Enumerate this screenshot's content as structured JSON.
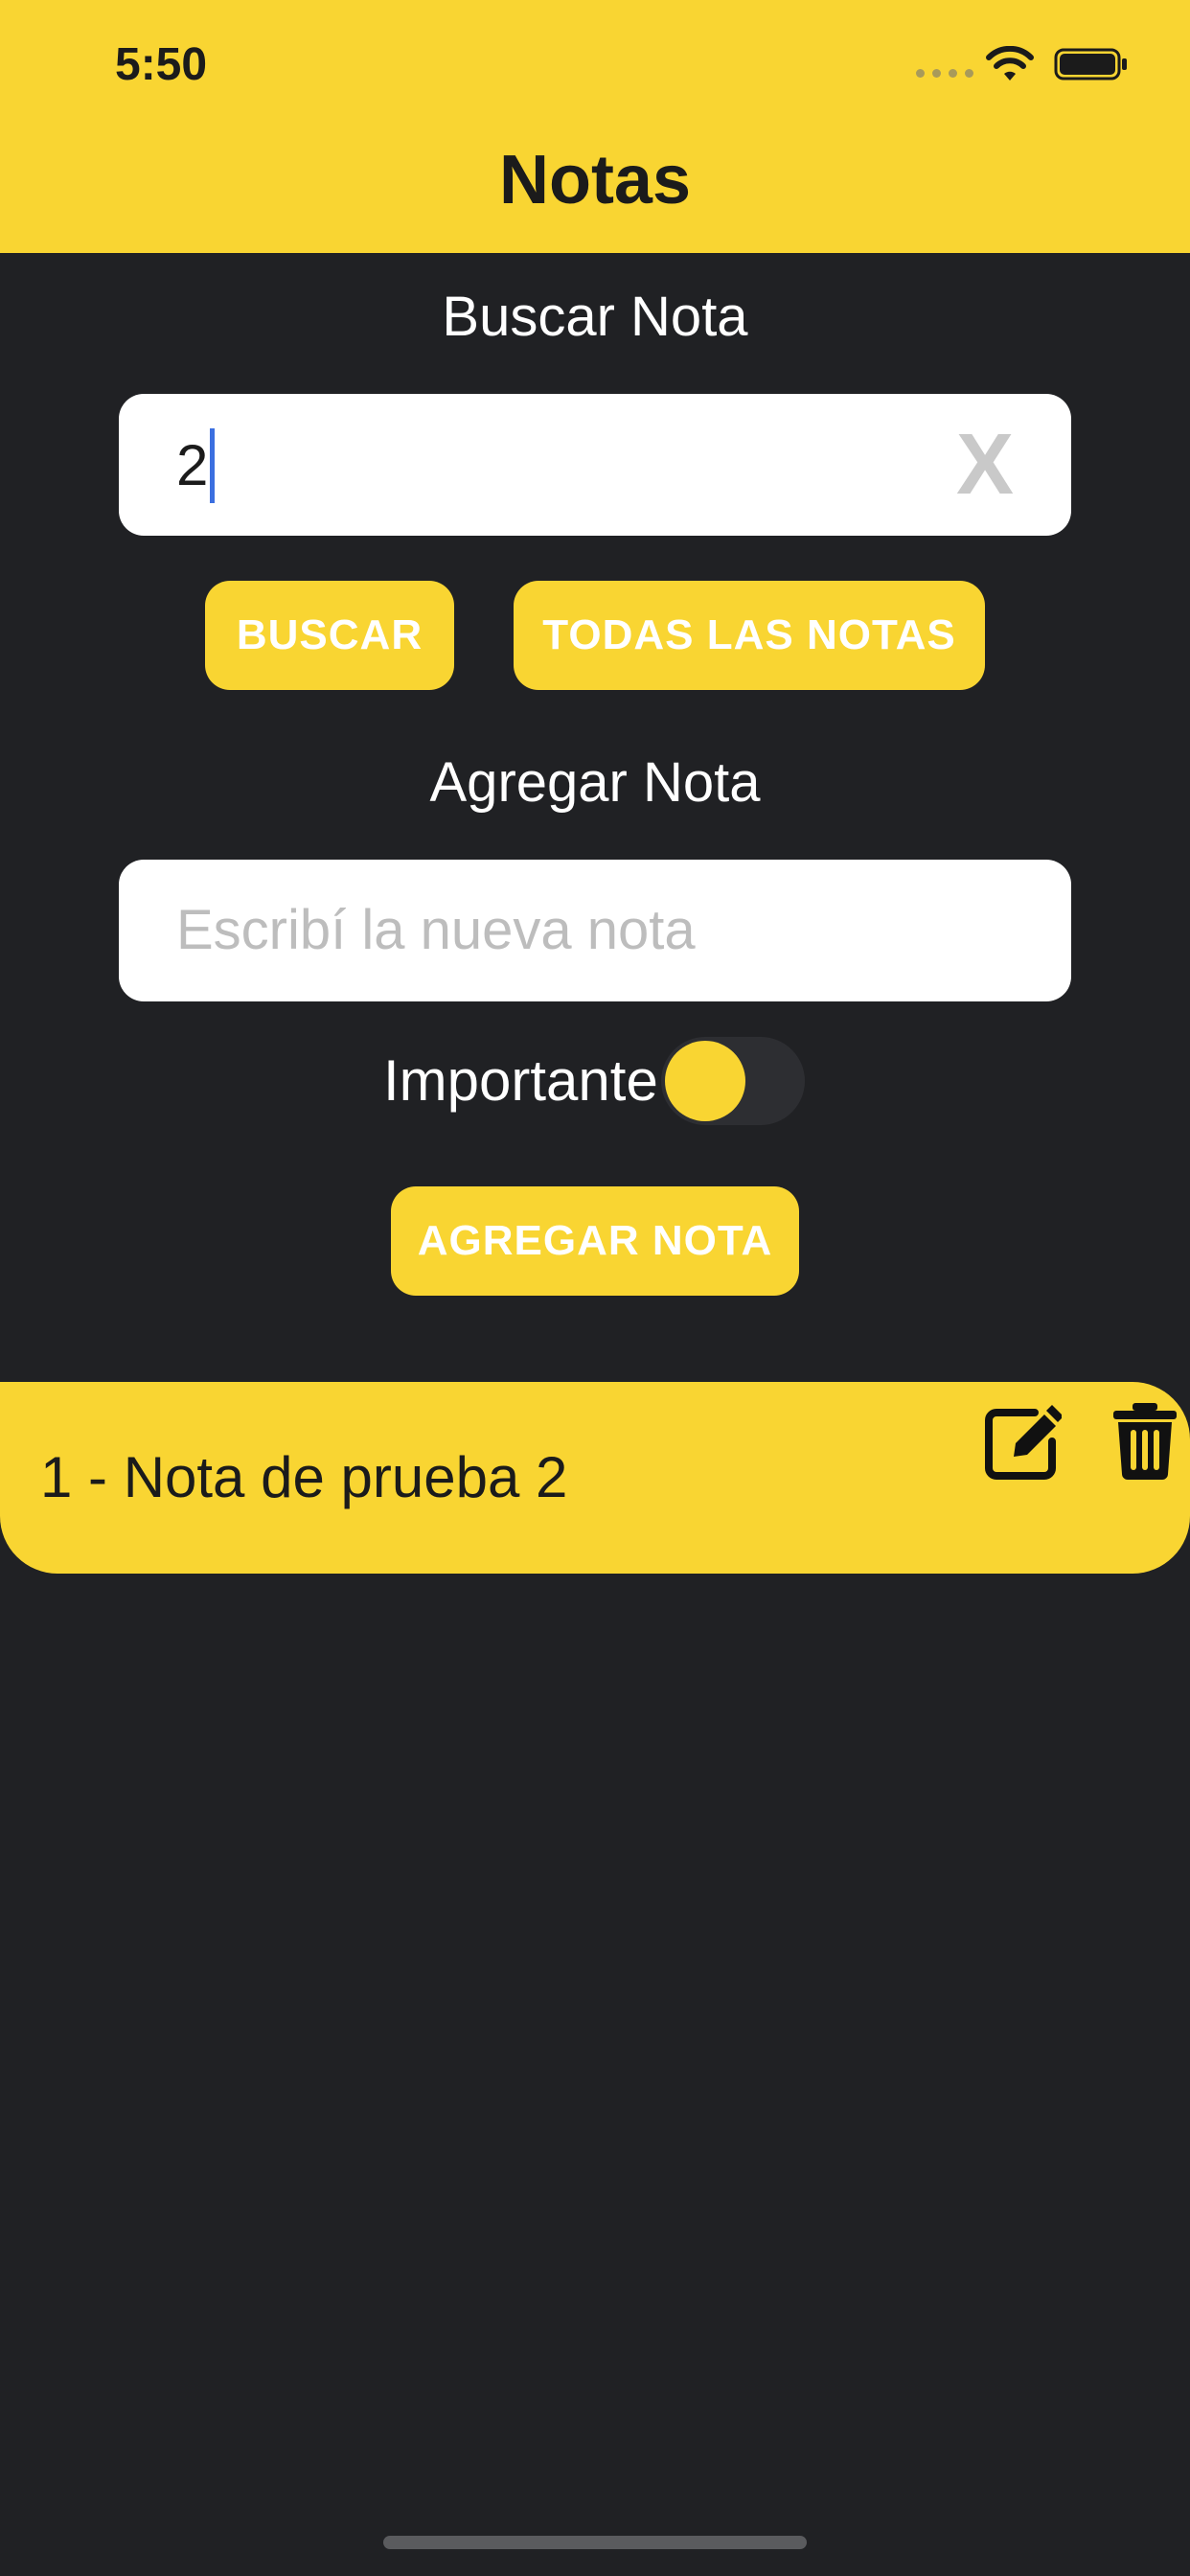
{
  "status_bar": {
    "time": "5:50"
  },
  "header": {
    "title": "Notas",
    "background_color": "#F9D532"
  },
  "search": {
    "label": "Buscar Nota",
    "value": "2",
    "clear_label": "X",
    "search_button": "BUSCAR",
    "all_notes_button": "TODAS LAS NOTAS"
  },
  "add": {
    "label": "Agregar Nota",
    "placeholder": "Escribí la nueva nota",
    "important_label": "Importante",
    "important_on": false,
    "add_button": "AGREGAR NOTA"
  },
  "notes": [
    {
      "text": "1 - Nota de prueba 2"
    }
  ],
  "icons": {
    "edit": "edit-icon",
    "delete": "trash-icon",
    "wifi": "wifi-icon",
    "battery": "battery-icon"
  },
  "colors": {
    "accent": "#F9D532",
    "background": "#202124",
    "caret": "#3b6fe0"
  }
}
